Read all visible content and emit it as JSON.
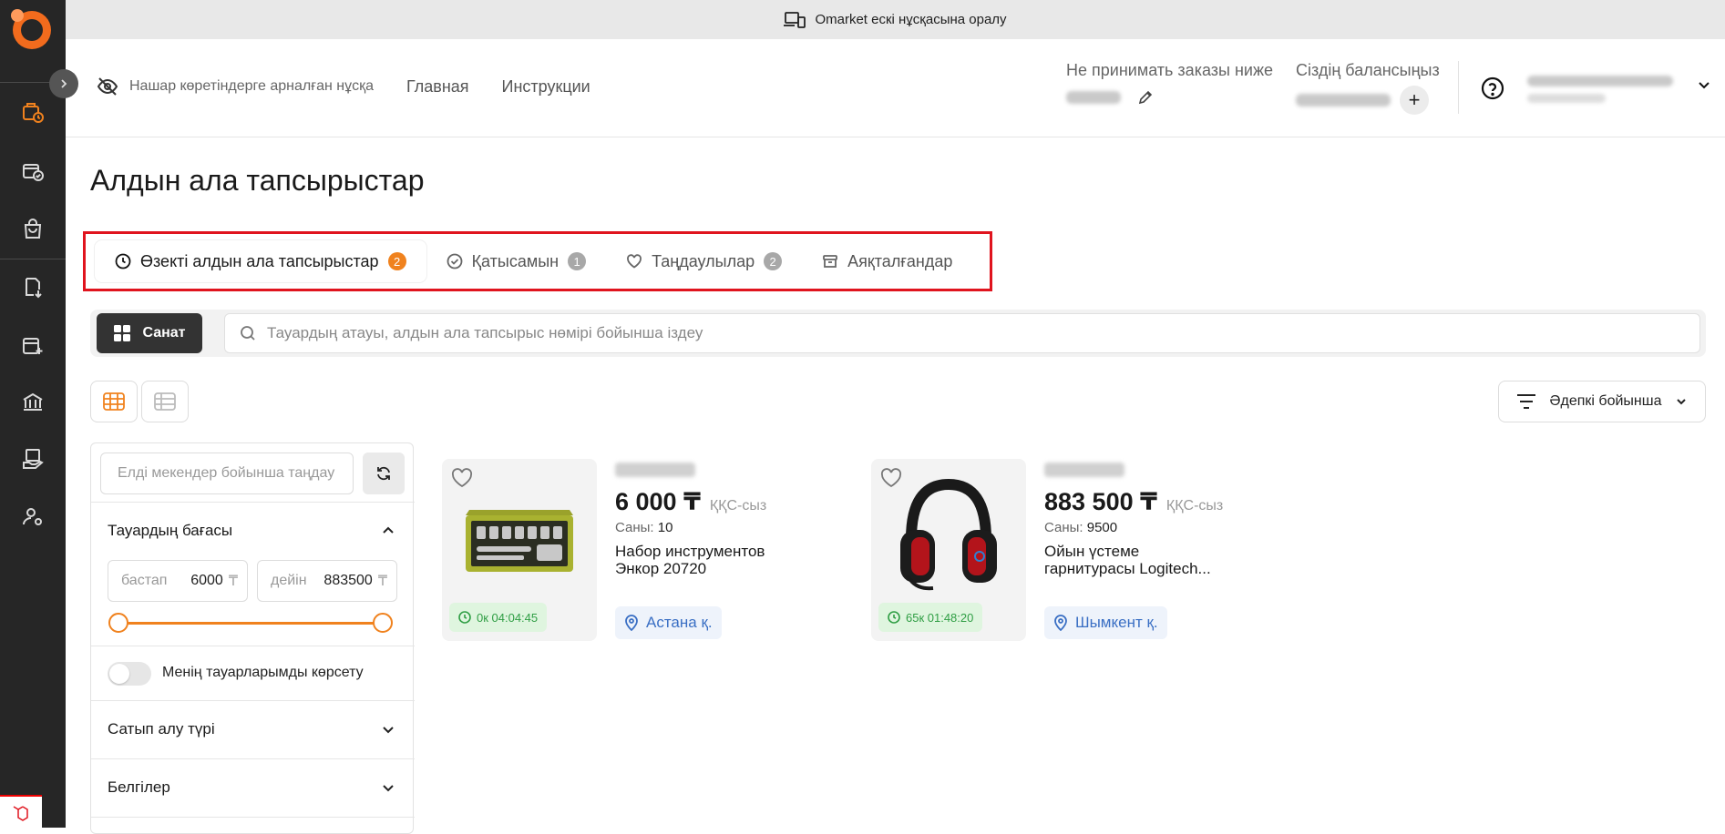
{
  "topbar": {
    "text": "Omarket ескі нұсқасына оралу"
  },
  "header": {
    "accessibility_label": "Нашар көретіндерге арналған нұсқа",
    "nav": [
      "Главная",
      "Инструкции"
    ],
    "min_order_label": "Не принимать заказы ниже",
    "balance_label": "Сіздің балансыңыз",
    "plus_label": "+"
  },
  "page": {
    "title": "Алдын ала тапсырыстар"
  },
  "tabs": [
    {
      "label": "Өзекті алдын ала тапсырыстар",
      "badge": "2",
      "icon": "clock-icon",
      "active": true
    },
    {
      "label": "Қатысамын",
      "badge": "1",
      "icon": "check-circle-icon",
      "active": false
    },
    {
      "label": "Таңдаулылар",
      "badge": "2",
      "icon": "heart-icon",
      "active": false
    },
    {
      "label": "Аяқталғандар",
      "badge": "",
      "icon": "archive-icon",
      "active": false
    }
  ],
  "search": {
    "category_label": "Санат",
    "placeholder": "Тауардың атауы, алдын ала тапсырыс нөмірі бойынша іздеу"
  },
  "sort": {
    "label": "Әдепкі бойынша"
  },
  "filters": {
    "location_placeholder": "Елді мекендер бойынша таңдау",
    "price_title": "Тауардың бағасы",
    "from_label": "бастап",
    "from_value": "6000",
    "to_label": "дейін",
    "to_value": "883500",
    "currency": "₸",
    "slider_min_fraction": 0,
    "slider_max_fraction": 1,
    "toggle_label": "Менің тауарларымды көрсету",
    "toggle_on": false,
    "purchase_type": "Сатып алу түрі",
    "tags": "Белгілер"
  },
  "products": [
    {
      "price": "6 000 ₸",
      "vat": "ҚҚС-сыз",
      "qty_label": "Саны:",
      "qty_value": "10",
      "name": "Набор инструментов Энкор 20720",
      "timer": "0к 04:04:45",
      "city": "Астана қ."
    },
    {
      "price": "883 500 ₸",
      "vat": "ҚҚС-сыз",
      "qty_label": "Саны:",
      "qty_value": "9500",
      "name": "Ойын үстеме гарнитурасы Logitech...",
      "timer": "65к 01:48:20",
      "city": "Шымкент қ."
    }
  ],
  "colors": {
    "accent": "#f0821e",
    "sidebar": "#262626",
    "highlight_border": "#e0141e",
    "timer_bg": "#dff5df",
    "city_text": "#3a6fc4"
  }
}
